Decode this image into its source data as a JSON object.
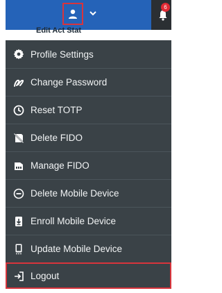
{
  "header": {
    "behind_text": "Edit Act    Stat",
    "notification_count": "6",
    "brand_color": "#2563b8",
    "highlight_color": "#d9343c"
  },
  "menu": {
    "items": [
      {
        "label": "Profile Settings",
        "icon": "gear-icon"
      },
      {
        "label": "Change Password",
        "icon": "password-icon"
      },
      {
        "label": "Reset TOTP",
        "icon": "clock-icon"
      },
      {
        "label": "Delete FIDO",
        "icon": "delete-key-icon"
      },
      {
        "label": "Manage FIDO",
        "icon": "key-device-icon"
      },
      {
        "label": "Delete Mobile Device",
        "icon": "minus-circle-icon"
      },
      {
        "label": "Enroll Mobile Device",
        "icon": "mobile-download-icon"
      },
      {
        "label": "Update Mobile Device",
        "icon": "mobile-icon"
      },
      {
        "label": "Logout",
        "icon": "logout-icon"
      }
    ]
  }
}
